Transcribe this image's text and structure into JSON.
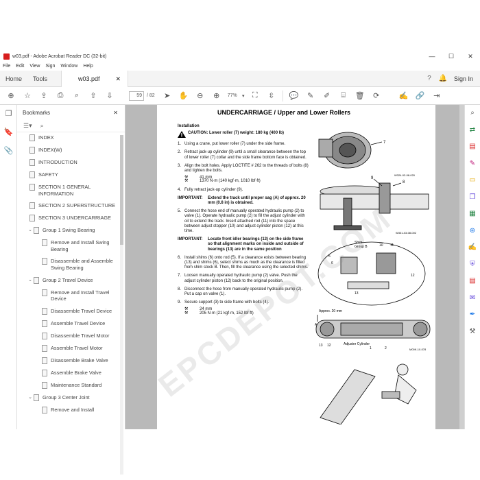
{
  "window": {
    "title": "w03.pdf - Adobe Acrobat Reader DC (32-bit)",
    "min": "—",
    "max": "☐",
    "close": "✕"
  },
  "menu": [
    "File",
    "Edit",
    "View",
    "Sign",
    "Window",
    "Help"
  ],
  "tabs": {
    "home": "Home",
    "tools": "Tools",
    "doc": "w03.pdf",
    "doc_close": "✕",
    "sign_in": "Sign In"
  },
  "toolbar": {
    "page_current": "59",
    "page_total": "/ 82",
    "zoom": "77%"
  },
  "bookmarks": {
    "title": "Bookmarks",
    "close": "✕",
    "items": [
      {
        "label": "INDEX",
        "chev": "",
        "indent": 0
      },
      {
        "label": "INDEX(W)",
        "chev": "",
        "indent": 0
      },
      {
        "label": "INTRODUCTION",
        "chev": "",
        "indent": 0
      },
      {
        "label": "SAFETY",
        "chev": "",
        "indent": 0
      },
      {
        "label": "SECTION 1 GENERAL INFORMATION",
        "chev": "",
        "indent": 0
      },
      {
        "label": "SECTION 2 SUPERSTRUCTURE",
        "chev": "",
        "indent": 0
      },
      {
        "label": "SECTION 3 UNDERCARRIAGE",
        "chev": "",
        "indent": 0
      },
      {
        "label": "Group 1 Swing Bearing",
        "chev": "⌄",
        "indent": 1
      },
      {
        "label": "Remove and Install Swing Bearing",
        "chev": "",
        "indent": 2
      },
      {
        "label": "Disassemble and Assemble Swing Bearing",
        "chev": "",
        "indent": 2
      },
      {
        "label": "Group 2 Travel Device",
        "chev": "⌄",
        "indent": 1
      },
      {
        "label": "Remove and Install Travel Device",
        "chev": "",
        "indent": 2
      },
      {
        "label": "Disassemble Travel Device",
        "chev": "",
        "indent": 2
      },
      {
        "label": "Assemble Travel Device",
        "chev": "",
        "indent": 2
      },
      {
        "label": "Disassemble Travel Motor",
        "chev": "",
        "indent": 2
      },
      {
        "label": "Assemble Travel Motor",
        "chev": "",
        "indent": 2
      },
      {
        "label": "Disassemble Brake Valve",
        "chev": "",
        "indent": 2
      },
      {
        "label": "Assemble Brake Valve",
        "chev": "",
        "indent": 2
      },
      {
        "label": "Maintenance Standard",
        "chev": "",
        "indent": 2
      },
      {
        "label": "Group 3 Center Joint",
        "chev": "⌄",
        "indent": 1
      },
      {
        "label": "Remove and Install",
        "chev": "",
        "indent": 2
      }
    ]
  },
  "document": {
    "title": "UNDERCARRIAGE / Upper and Lower Rollers",
    "heading": "Installation",
    "caution": "CAUTION: Lower roller (7) weight: 180 kg (400 lb)",
    "step1": "Using a crane, put lower roller (7) under the side frame.",
    "step2": "Retract jack-up cylinder (9) until a small clearance between the top of lower roller (7) collar and the side frame bottom face is obtained.",
    "step3": "Align the bolt holes. Apply LOCTITE # 262 to the threads of bolts (8) and tighten the bolts.",
    "step3_size": "41 mm",
    "step3_torque": "1370 N·m (140 kgf·m, 1010 lbf·ft)",
    "step4": "Fully retract jack-up cylinder (9).",
    "imp1_k": "IMPORTANT:",
    "imp1": "Extend the track until proper sag (A) of approx. 20 mm (0.8 in) is obtained.",
    "step5": "Connect the hose end of manually operated hydraulic pump (2) to valve (1). Operate hydraulic pump (2) to fill the adjust cylinder with oil to extend the track. Insert attached rod (11) into the space between adjust stopper (10) and adjust cylinder piston (12) at this time.",
    "imp2_k": "IMPORTANT:",
    "imp2": "Locate front idler bearings (13) on the side frame so that alignment marks on inside and outside of bearings (13) are in the same position",
    "step6": "Install shims (6) onto rod (5). If a clearance exists between bearing (13) and shims (6), select shims as much as the clearance is filled from shim stock B. Then, fill the clearance using the selected shims.",
    "step7": "Loosen manually operated hydraulic pump (2) valve. Push the adjust cylinder piston (12) back to the original position.",
    "step8": "Disconnect the hose from manually operated hydraulic pump (2). Put a cap on valve (1).",
    "step9": "Secure support (3) to side frame with bolts (4).",
    "step9_size": "24 mm",
    "step9_torque": "205 N·m (21 kgf·m, 152 lbf·ft)",
    "fig1_code": "W324-03-08-020",
    "fig2_code": "W331-03-08-002",
    "fig3_code": "M00K-10-078",
    "labels": {
      "l7": "7",
      "l9": "9",
      "l8": "8",
      "shim": "Shim",
      "groupb": "Group B",
      "l10": "10",
      "l11": "11",
      "l5": "5",
      "l6": "6",
      "l13": "13",
      "l12": "12",
      "approx": "Approx. 20 mm",
      "a": "A",
      "l13b": "13",
      "l12b": "12",
      "adjuster": "Adjuster Cylinder",
      "l1": "1",
      "l2": "2"
    },
    "watermark": "EPCDEPOT.COM"
  },
  "colors": {
    "accent": "#1473e6",
    "adobe_red": "#d71e1e",
    "doc_bg": "#b9b9b9"
  }
}
